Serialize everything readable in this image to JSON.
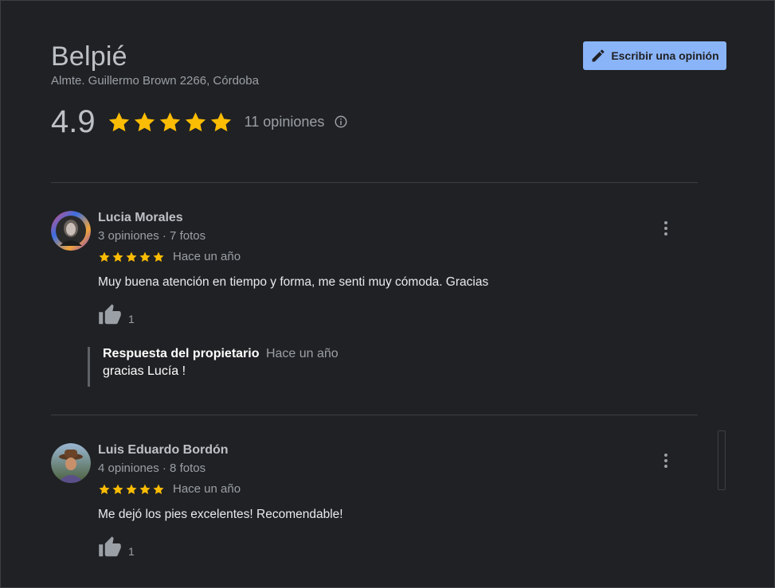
{
  "business": {
    "name": "Belpié",
    "address": "Almte. Guillermo Brown 2266, Córdoba",
    "rating": "4.9",
    "stars": 5,
    "review_count": "11 opiniones"
  },
  "actions": {
    "write_review_label": "Escribir una opinión"
  },
  "colors": {
    "background": "#202124",
    "star": "#fbbc04",
    "button_bg": "#8ab4f8",
    "text_primary": "#e8eaed",
    "text_secondary": "#9aa0a6"
  },
  "icons": [
    "pencil-icon",
    "star-icon",
    "info-icon",
    "more-vert-icon",
    "thumbs-up-icon"
  ],
  "reviews": [
    {
      "author": "Lucia Morales",
      "meta": "3 opiniones · 7 fotos",
      "stars": 5,
      "date": "Hace un año",
      "text": "Muy buena atención en tiempo y forma, me senti muy cómoda. Gracias",
      "likes": "1",
      "owner_reply": {
        "label": "Respuesta del propietario",
        "date": "Hace un año",
        "text": "gracias Lucía !"
      }
    },
    {
      "author": "Luis Eduardo Bordón",
      "meta": "4 opiniones · 8 fotos",
      "stars": 5,
      "date": "Hace un año",
      "text": "Me dejó los pies excelentes! Recomendable!",
      "likes": "1"
    }
  ]
}
